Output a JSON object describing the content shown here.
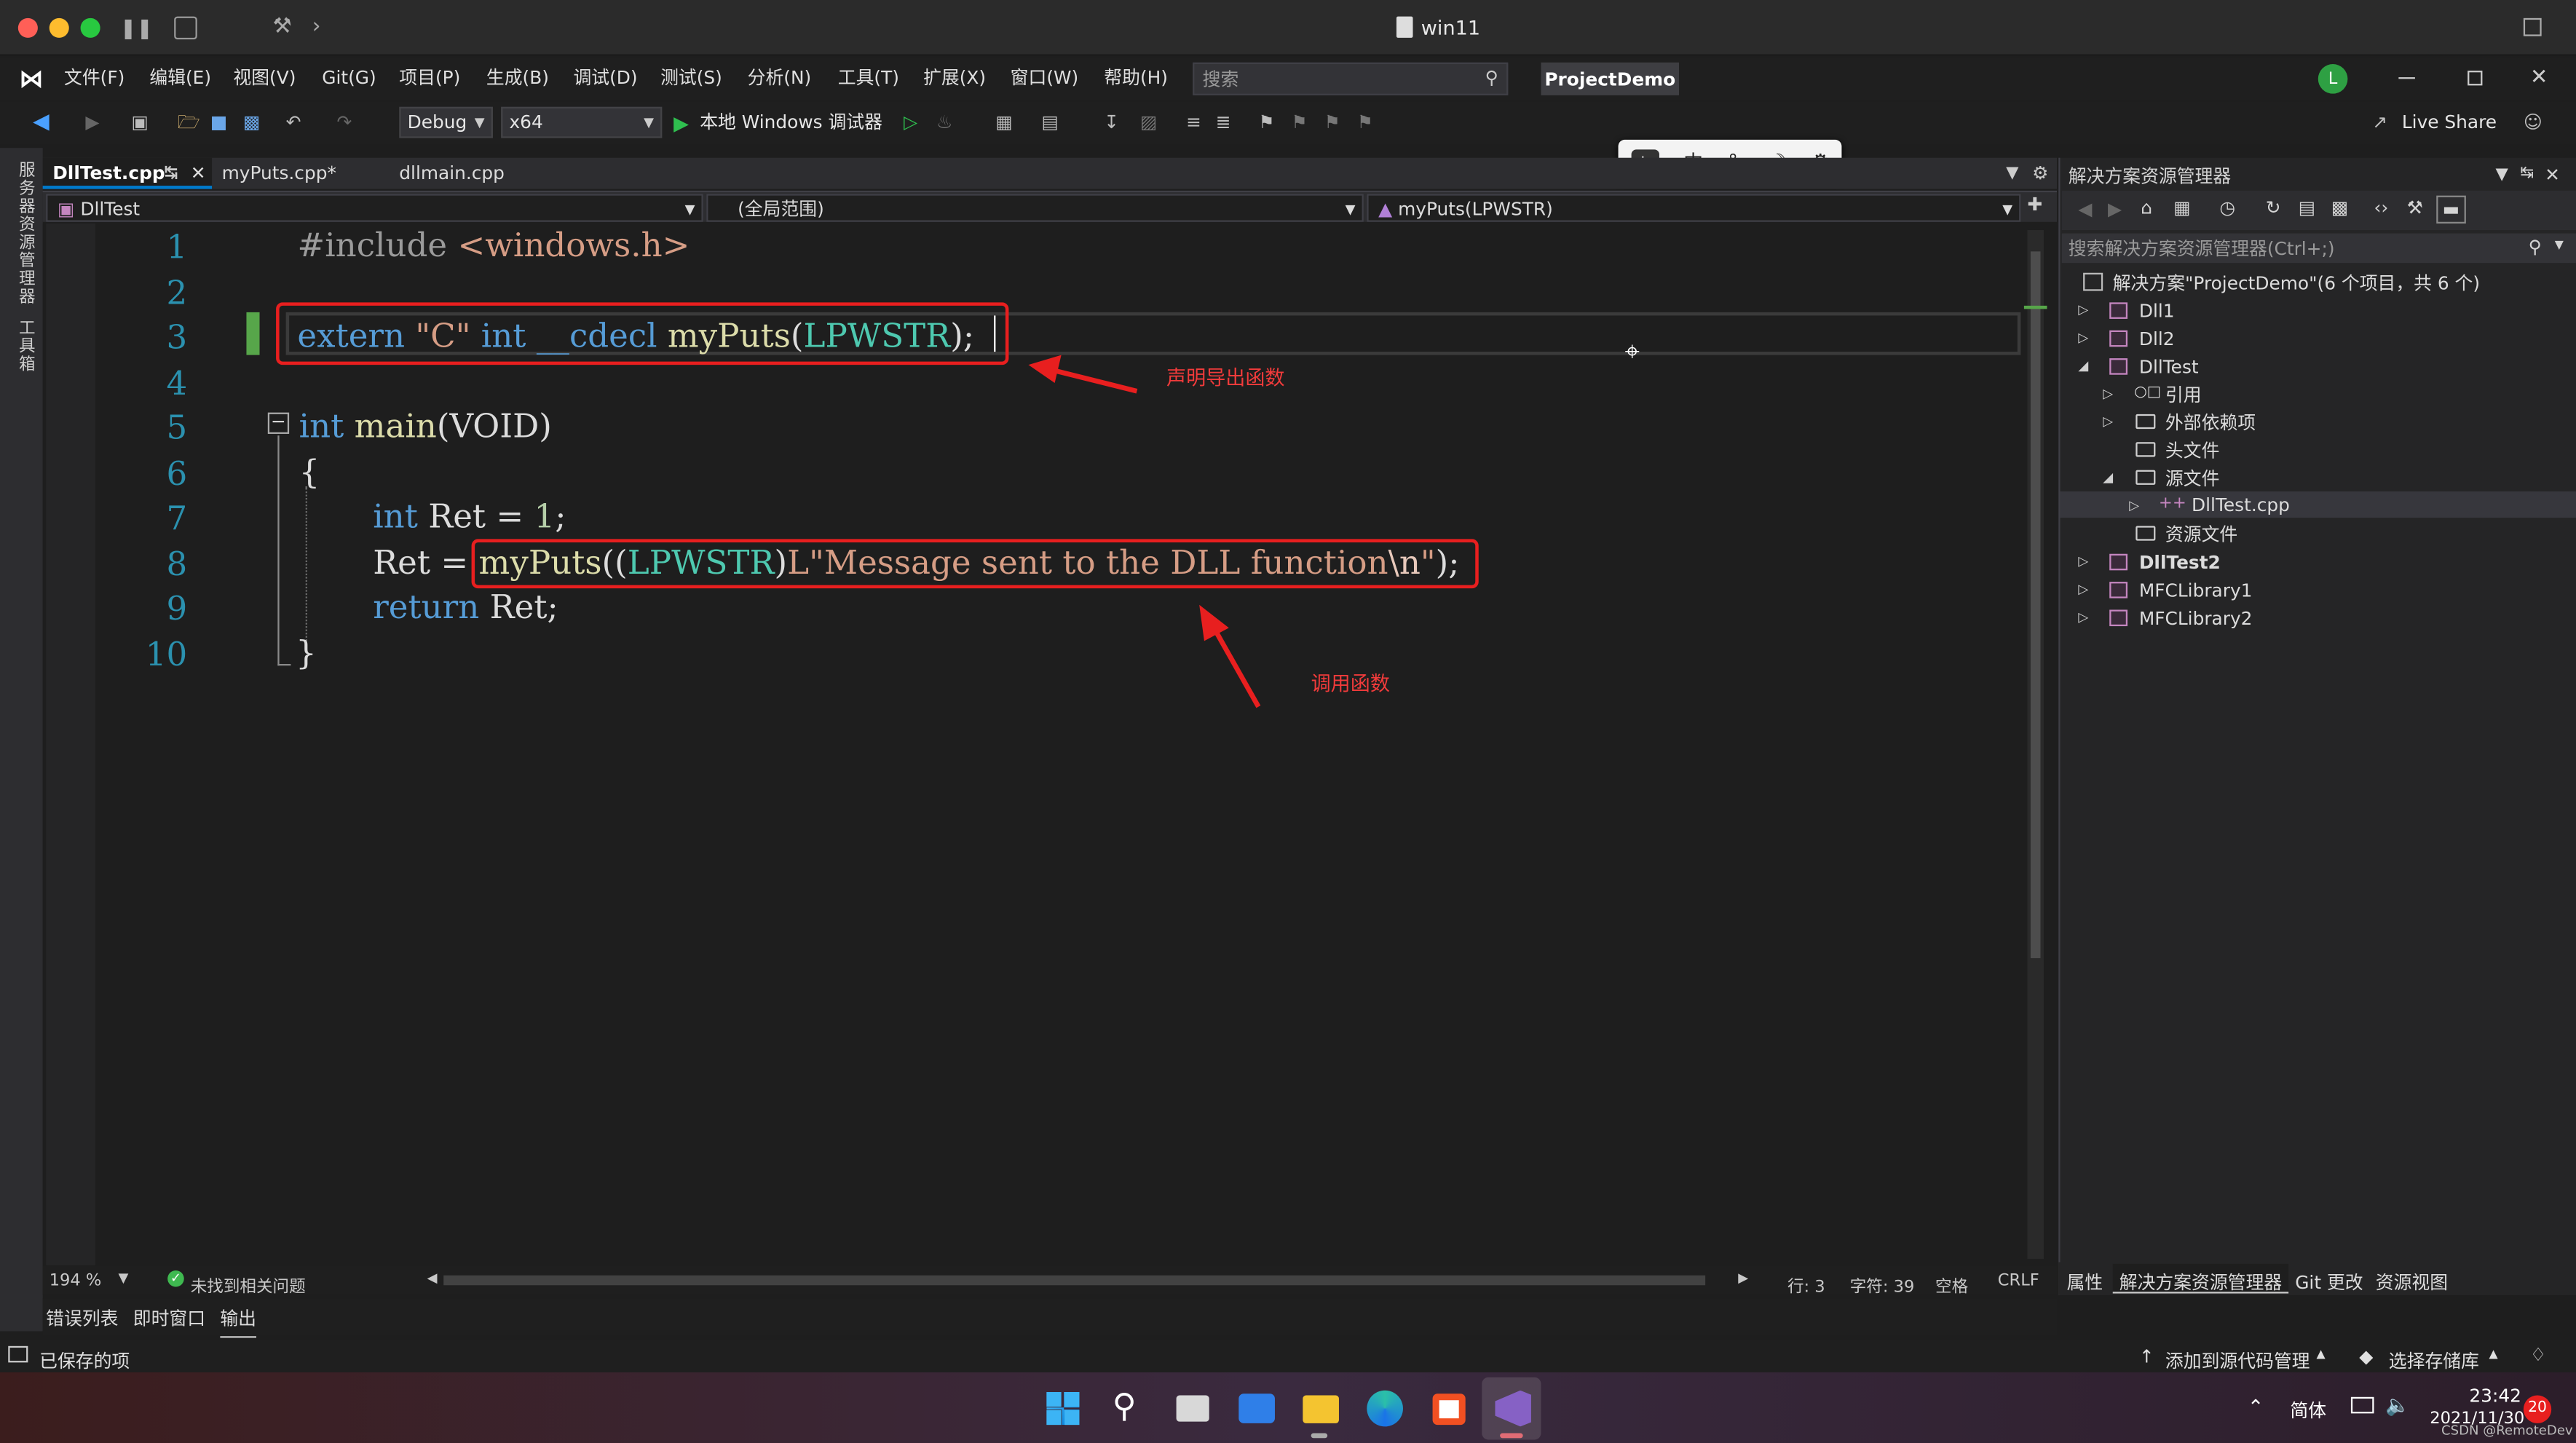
{
  "window": {
    "title": "win11"
  },
  "menu": {
    "items": [
      "文件(F)",
      "编辑(E)",
      "视图(V)",
      "Git(G)",
      "项目(P)",
      "生成(B)",
      "调试(D)",
      "测试(S)",
      "分析(N)",
      "工具(T)",
      "扩展(X)",
      "窗口(W)",
      "帮助(H)"
    ],
    "search_placeholder": "搜索",
    "project_name": "ProjectDemo",
    "avatar_letter": "L"
  },
  "toolbar": {
    "config": "Debug",
    "platform": "x64",
    "run_label": "本地 Windows 调试器",
    "live_share": "Live Share"
  },
  "ime": {
    "lang": "中",
    "punct": "°,"
  },
  "left_strip": {
    "item1": "服务器资源管理器",
    "item2": "工具箱"
  },
  "tabs": [
    {
      "label": "DllTest.cpp",
      "active": true
    },
    {
      "label": "myPuts.cpp*"
    },
    {
      "label": "dllmain.cpp"
    }
  ],
  "navbar": {
    "project": "DllTest",
    "scope": "(全局范围)",
    "member": "myPuts(LPWSTR)"
  },
  "code": {
    "line_numbers": [
      "1",
      "2",
      "3",
      "4",
      "5",
      "6",
      "7",
      "8",
      "9",
      "10"
    ],
    "l1_directive": "#include",
    "l1_header": "<windows.h>",
    "l3_extern": "extern",
    "l3_c": "\"C\"",
    "l3_int": "int",
    "l3_cdecl": "__cdecl",
    "l3_fn": "myPuts",
    "l3_open": "(",
    "l3_type": "LPWSTR",
    "l3_close": ");",
    "l5_int": "int",
    "l5_main": "main",
    "l5_params": "(VOID)",
    "l6": "{",
    "l7_int": "int",
    "l7_rest": "Ret = ",
    "l7_num": "1",
    "l7_semi": ";",
    "l8_lhs": "Ret = ",
    "l8_fn": "myPuts",
    "l8_cast_open": "((",
    "l8_type": "LPWSTR",
    "l8_cast_close": ")",
    "l8_str": "L\"Message sent to the DLL function",
    "l8_esc": "\\n",
    "l8_strend": "\"",
    "l8_end": ");",
    "l9_return": "return",
    "l9_rest": " Ret;",
    "l10": "}"
  },
  "annotations": {
    "declare": "声明导出函数",
    "call": "调用函数",
    "color": "#e81f1f"
  },
  "editor_status": {
    "zoom": "194 %",
    "issues": "未找到相关问题",
    "line": "行: 3",
    "char": "字符: 39",
    "space": "空格",
    "eol": "CRLF"
  },
  "bottom_tabs": [
    "错误列表",
    "即时窗口",
    "输出"
  ],
  "solution_explorer": {
    "title": "解决方案资源管理器",
    "search_placeholder": "搜索解决方案资源管理器(Ctrl+;)",
    "solution": "解决方案\"ProjectDemo\"(6 个项目，共 6 个)",
    "items": {
      "dll1": "Dll1",
      "dll2": "Dll2",
      "dlltest": "DllTest",
      "ref": "引用",
      "extdeps": "外部依赖项",
      "headers": "头文件",
      "sources": "源文件",
      "dlltestcpp": "DllTest.cpp",
      "resources": "资源文件",
      "dlltest2": "DllTest2",
      "mfc1": "MFCLibrary1",
      "mfc2": "MFCLibrary2"
    },
    "bottom_tabs": [
      "属性",
      "解决方案资源管理器",
      "Git 更改",
      "资源视图"
    ]
  },
  "status_bar": {
    "saved": "已保存的项",
    "add_source": "添加到源代码管理",
    "select_repo": "选择存储库"
  },
  "taskbar": {
    "ime": "简体",
    "time": "23:42",
    "date": "2021/11/30",
    "badge": "20",
    "watermark": "CSDN @RemoteDev"
  }
}
